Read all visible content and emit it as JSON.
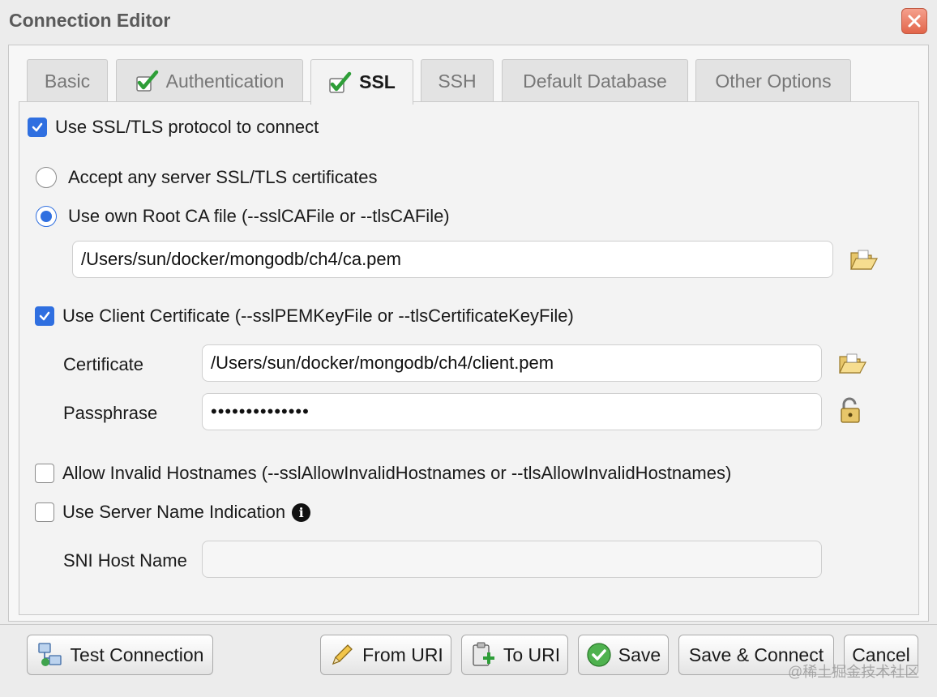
{
  "window": {
    "title": "Connection Editor"
  },
  "tabs": [
    {
      "label": "Basic"
    },
    {
      "label": "Authentication"
    },
    {
      "label": "SSL"
    },
    {
      "label": "SSH"
    },
    {
      "label": "Default Database"
    },
    {
      "label": "Other Options"
    }
  ],
  "ssl": {
    "use_ssl_label": "Use SSL/TLS protocol to connect",
    "accept_any_label": "Accept any server SSL/TLS certificates",
    "own_ca_label": "Use own Root CA file (--sslCAFile or --tlsCAFile)",
    "ca_file_value": "/Users/sun/docker/mongodb/ch4/ca.pem",
    "client_cert_label": "Use Client Certificate (--sslPEMKeyFile or --tlsCertificateKeyFile)",
    "certificate_label": "Certificate",
    "certificate_value": "/Users/sun/docker/mongodb/ch4/client.pem",
    "passphrase_label": "Passphrase",
    "passphrase_value": "••••••••••••••",
    "allow_invalid_label": "Allow Invalid Hostnames (--sslAllowInvalidHostnames or --tlsAllowInvalidHostnames)",
    "sni_label": "Use Server Name Indication",
    "sni_host_label": "SNI Host Name",
    "sni_host_value": ""
  },
  "buttons": {
    "test_connection": "Test Connection",
    "from_uri": "From URI",
    "to_uri": "To URI",
    "save": "Save",
    "save_connect": "Save & Connect",
    "cancel": "Cancel"
  },
  "watermark": "@稀土掘金技术社区",
  "colors": {
    "accent": "#2f6fe0",
    "close": "#e2654a"
  }
}
